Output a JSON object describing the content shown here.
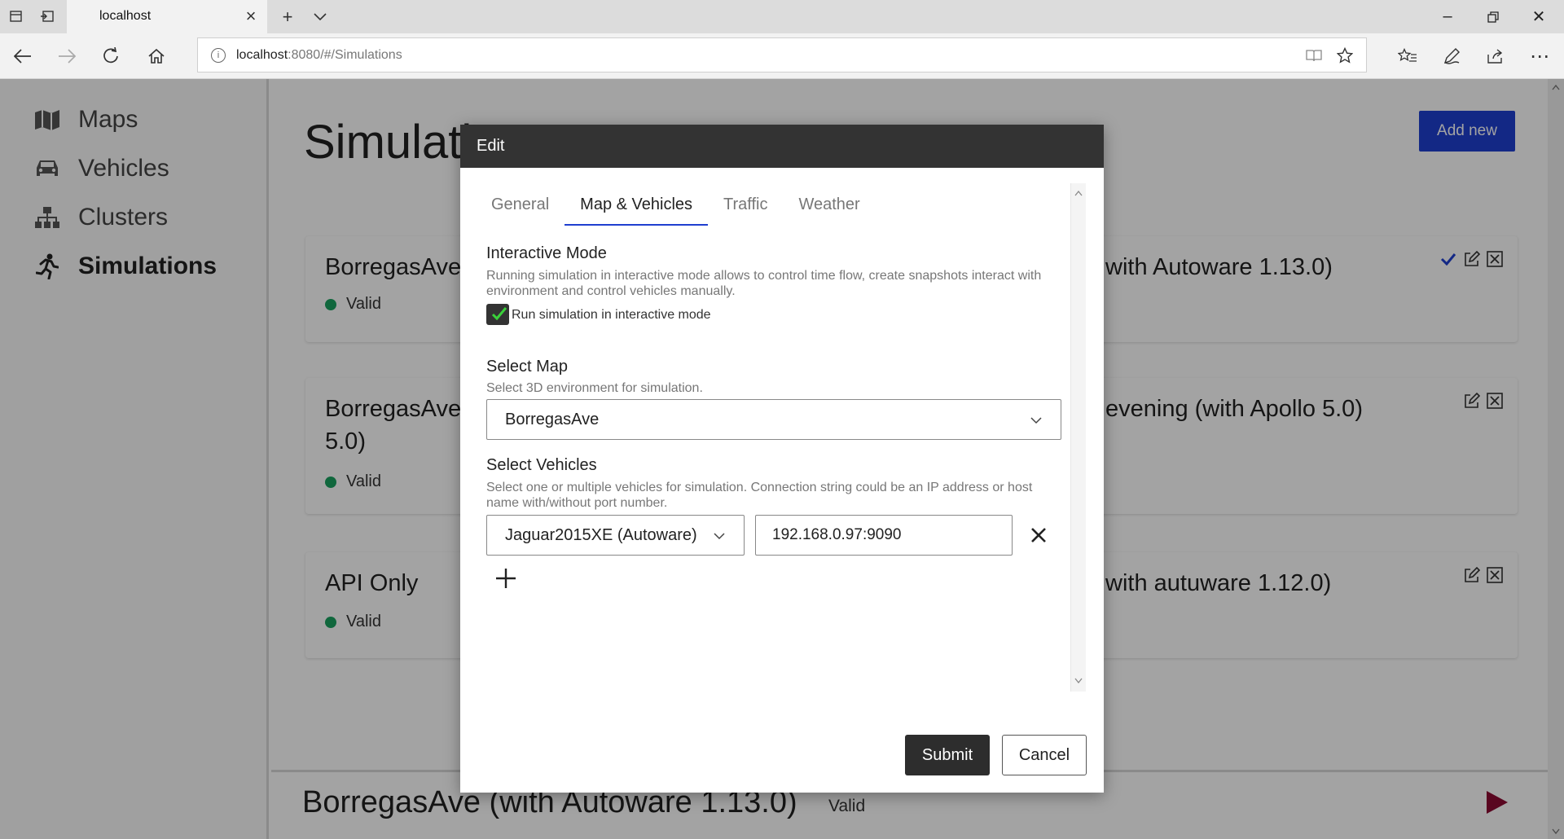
{
  "browser": {
    "tab_title": "localhost",
    "address_host": "localhost",
    "address_rest": ":8080/#/Simulations"
  },
  "sidebar": {
    "items": [
      {
        "label": "Maps",
        "icon": "map-icon"
      },
      {
        "label": "Vehicles",
        "icon": "car-icon"
      },
      {
        "label": "Clusters",
        "icon": "cluster-icon"
      },
      {
        "label": "Simulations",
        "icon": "runner-icon"
      }
    ]
  },
  "main": {
    "title": "Simulations",
    "add_new_label": "Add new",
    "cards": [
      {
        "name": "BorregasAve",
        "name_right": "with Autoware 1.13.0)",
        "status": "Valid"
      },
      {
        "name": "BorregasAve",
        "name_line2": "5.0)",
        "name_right": "evening (with Apollo 5.0)",
        "status": "Valid"
      },
      {
        "name": "API Only",
        "name_right": "with autuware 1.12.0)",
        "status": "Valid"
      }
    ],
    "bottom": {
      "name": "BorregasAve (with Autoware 1.13.0)",
      "status": "Valid"
    }
  },
  "modal": {
    "title": "Edit",
    "tabs": [
      "General",
      "Map & Vehicles",
      "Traffic",
      "Weather"
    ],
    "active_tab": "Map & Vehicles",
    "interactive": {
      "title": "Interactive Mode",
      "desc": "Running simulation in interactive mode allows to control time flow, create snapshots interact with environment and control vehicles manually.",
      "checkbox_label": "Run simulation in interactive mode",
      "checked": true
    },
    "map": {
      "title": "Select Map",
      "desc": "Select 3D environment for simulation.",
      "value": "BorregasAve"
    },
    "vehicles": {
      "title": "Select Vehicles",
      "desc": "Select one or multiple vehicles for simulation. Connection string could be an IP address or host name with/without port number.",
      "vehicle": "Jaguar2015XE (Autoware)",
      "connection": "192.168.0.97:9090"
    },
    "submit_label": "Submit",
    "cancel_label": "Cancel"
  },
  "colors": {
    "accent": "#1f3fd0",
    "valid": "#1aa260",
    "play": "#8b0a32",
    "modal_header": "#333333"
  }
}
